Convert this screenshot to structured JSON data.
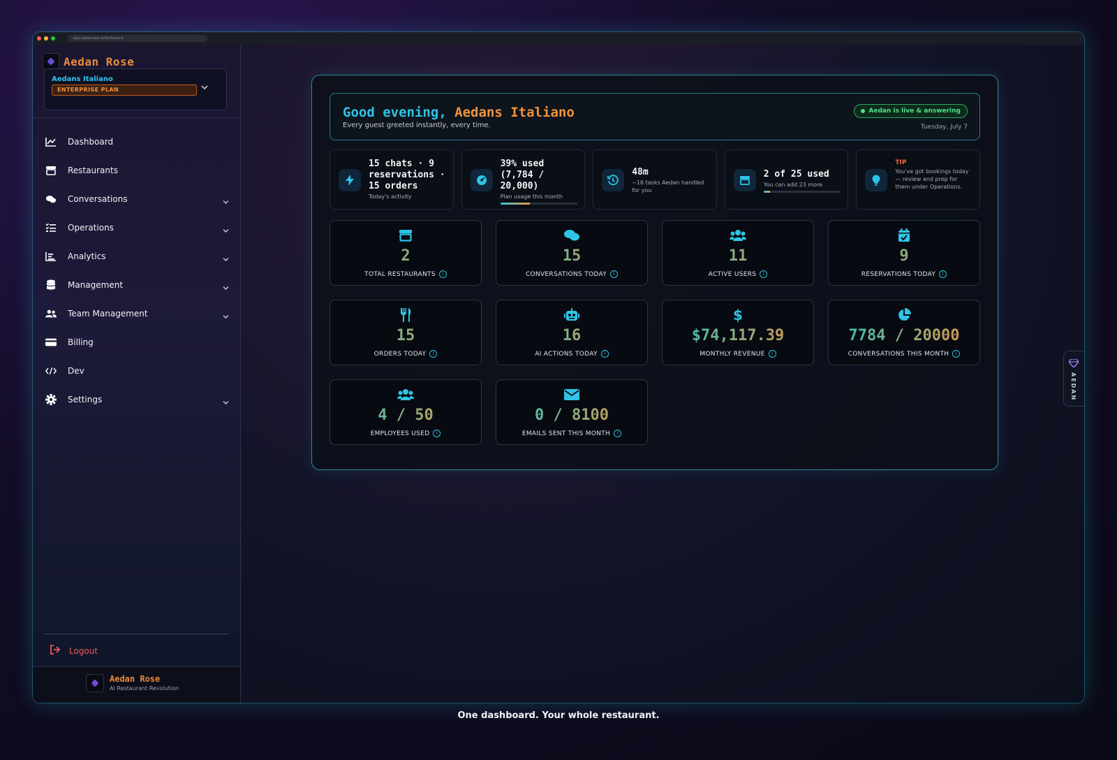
{
  "browser": {
    "url": "app.aedanrose.ai/dashboard"
  },
  "brand": {
    "name": "Aedan Rose",
    "tagline": "AI Restaurant Revolution"
  },
  "account": {
    "name": "Aedans Italiano",
    "plan": "ENTERPRISE PLAN"
  },
  "sidebar": {
    "items": [
      {
        "label": "Dashboard",
        "icon": "chart-line-icon",
        "expandable": false
      },
      {
        "label": "Restaurants",
        "icon": "store-icon",
        "expandable": false
      },
      {
        "label": "Conversations",
        "icon": "comments-icon",
        "expandable": true
      },
      {
        "label": "Operations",
        "icon": "list-check-icon",
        "expandable": true
      },
      {
        "label": "Analytics",
        "icon": "chart-bar-icon",
        "expandable": true
      },
      {
        "label": "Management",
        "icon": "database-icon",
        "expandable": true
      },
      {
        "label": "Team Management",
        "icon": "users-icon",
        "expandable": true
      },
      {
        "label": "Billing",
        "icon": "credit-card-icon",
        "expandable": false
      },
      {
        "label": "Dev",
        "icon": "code-icon",
        "expandable": false
      },
      {
        "label": "Settings",
        "icon": "gear-icon",
        "expandable": true
      }
    ],
    "logout": "Logout"
  },
  "greeting": {
    "prefix": "Good evening,",
    "name": "Aedans Italiano",
    "subtitle": "Every guest greeted instantly, every time.",
    "live_status": "Aedan is live & answering",
    "date": "Tuesday, July 7"
  },
  "summary_cards": [
    {
      "icon": "bolt-icon",
      "main": "15 chats · 9 reservations · 15 orders",
      "sub": "Today's activity"
    },
    {
      "icon": "gauge-icon",
      "main": "39% used (7,784 / 20,000)",
      "sub": "Plan usage this month",
      "progress": 0.39
    },
    {
      "icon": "history-icon",
      "main": "48m",
      "sub": "~16 tasks Aedan handled for you"
    },
    {
      "icon": "store-icon",
      "main": "2 of 25 used",
      "sub": "You can add 23 more",
      "progress": 0.08
    },
    {
      "icon": "lightbulb-icon",
      "tip": "TIP",
      "sub": "You've got bookings today — review and prep for them under Operations."
    }
  ],
  "stats": [
    {
      "icon": "store-icon",
      "value": "2",
      "label": "TOTAL RESTAURANTS"
    },
    {
      "icon": "comments-icon",
      "value": "15",
      "label": "CONVERSATIONS TODAY"
    },
    {
      "icon": "users-icon",
      "value": "11",
      "label": "ACTIVE USERS"
    },
    {
      "icon": "calendar-check-icon",
      "value": "9",
      "label": "RESERVATIONS TODAY"
    },
    {
      "icon": "utensils-icon",
      "value": "15",
      "label": "ORDERS TODAY"
    },
    {
      "icon": "robot-icon",
      "value": "16",
      "label": "AI ACTIONS TODAY"
    },
    {
      "icon": "dollar-icon",
      "value": "$74,117.39",
      "label": "MONTHLY REVENUE"
    },
    {
      "icon": "pie-chart-icon",
      "value": "7784 / 20000",
      "label": "CONVERSATIONS THIS MONTH"
    },
    {
      "icon": "users-icon",
      "value": "4 / 50",
      "label": "EMPLOYEES USED"
    },
    {
      "icon": "envelope-icon",
      "value": "0 / 8100",
      "label": "EMAILS SENT THIS MONTH"
    }
  ],
  "side_tab": "AEDAN",
  "caption": "One dashboard. Your whole restaurant.",
  "colors": {
    "accent": "#2ec4e6",
    "brand": "#e88b3a",
    "live": "#4fe08a",
    "logout": "#ef5a5a"
  }
}
